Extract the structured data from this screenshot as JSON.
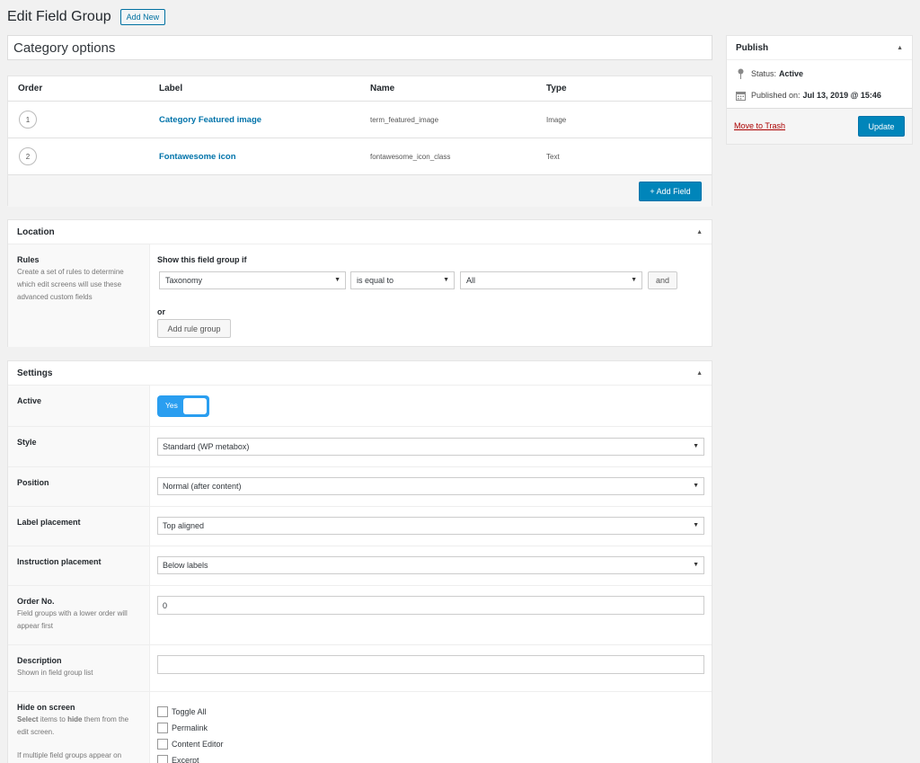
{
  "header": {
    "title": "Edit Field Group",
    "add_new": "Add New"
  },
  "title_value": "Category options",
  "fields": {
    "columns": [
      "Order",
      "Label",
      "Name",
      "Type"
    ],
    "rows": [
      {
        "order": "1",
        "label": "Category Featured image",
        "name": "term_featured_image",
        "type": "Image"
      },
      {
        "order": "2",
        "label": "Fontawesome icon",
        "name": "fontawesome_icon_class",
        "type": "Text"
      }
    ],
    "add_field": "+ Add Field"
  },
  "location": {
    "title": "Location",
    "rules_label": "Rules",
    "rules_desc": "Create a set of rules to determine which edit screens will use these advanced custom fields",
    "show_if": "Show this field group if",
    "param": "Taxonomy",
    "operator": "is equal to",
    "value": "All",
    "and": "and",
    "or": "or",
    "add_rule_group": "Add rule group"
  },
  "settings": {
    "title": "Settings",
    "active_label": "Active",
    "active_value": "Yes",
    "style_label": "Style",
    "style_value": "Standard (WP metabox)",
    "position_label": "Position",
    "position_value": "Normal (after content)",
    "label_placement_label": "Label placement",
    "label_placement_value": "Top aligned",
    "instruction_label": "Instruction placement",
    "instruction_value": "Below labels",
    "order_label": "Order No.",
    "order_desc": "Field groups with a lower order will appear first",
    "order_value": "0",
    "desc_label": "Description",
    "desc_desc": "Shown in field group list",
    "desc_value": "",
    "hide_label": "Hide on screen",
    "hide_desc_pre": "Select",
    "hide_desc_items": "items to",
    "hide_desc_hide": "hide",
    "hide_desc_post": "them from the edit screen.",
    "hide_desc2": "If multiple field groups appear on",
    "hide_options": [
      "Toggle All",
      "Permalink",
      "Content Editor",
      "Excerpt"
    ]
  },
  "publish": {
    "title": "Publish",
    "status_label": "Status:",
    "status_value": "Active",
    "published_label": "Published on:",
    "published_value": "Jul 13, 2019 @ 15:46",
    "trash": "Move to Trash",
    "update": "Update"
  }
}
